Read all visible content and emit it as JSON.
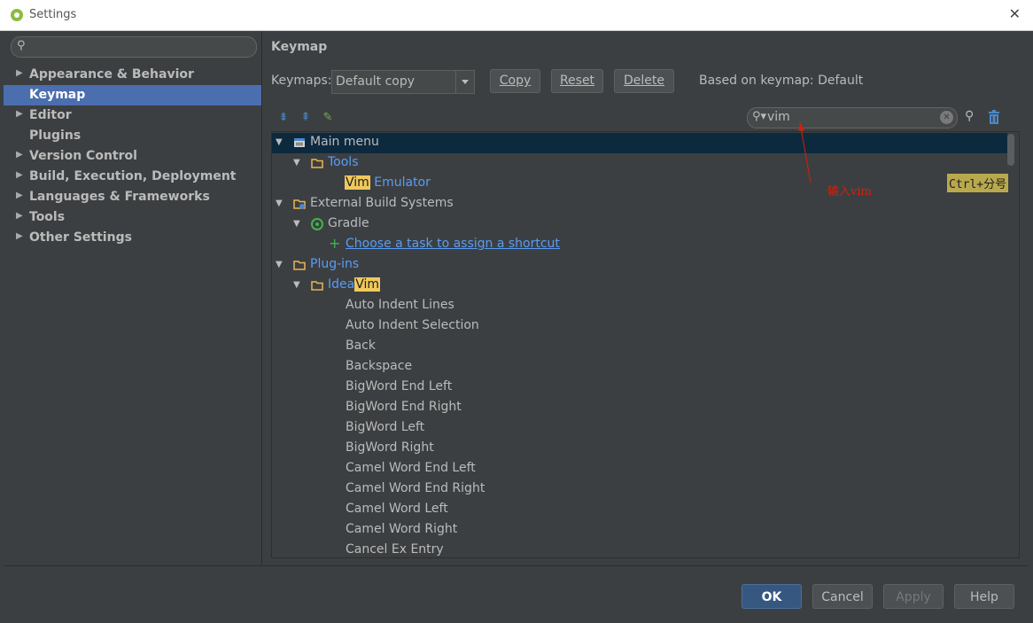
{
  "window": {
    "title": "Settings"
  },
  "sidebar": {
    "search_placeholder": "",
    "items": [
      {
        "label": "Appearance & Behavior",
        "has_arrow": true
      },
      {
        "label": "Keymap",
        "has_arrow": false,
        "selected": true
      },
      {
        "label": "Editor",
        "has_arrow": true
      },
      {
        "label": "Plugins",
        "has_arrow": false
      },
      {
        "label": "Version Control",
        "has_arrow": true
      },
      {
        "label": "Build, Execution, Deployment",
        "has_arrow": true
      },
      {
        "label": "Languages & Frameworks",
        "has_arrow": true
      },
      {
        "label": "Tools",
        "has_arrow": true
      },
      {
        "label": "Other Settings",
        "has_arrow": true
      }
    ]
  },
  "keymap": {
    "heading": "Keymap",
    "keymaps_label": "Keymaps:",
    "selected_keymap": "Default copy",
    "copy_label": "Copy",
    "reset_label": "Reset",
    "delete_label": "Delete",
    "based_on": "Based on keymap: Default",
    "filter_value": "vim"
  },
  "tree": {
    "main_menu": "Main menu",
    "tools": "Tools",
    "vim_emulator_hl": "Vim",
    "vim_emulator_rest": " Emulator",
    "vim_emulator_shortcut": "Ctrl+分号",
    "external_build": "External Build Systems",
    "gradle": "Gradle",
    "choose_task": "Choose a task to assign a shortcut",
    "plugins": "Plug-ins",
    "ideavim_pre": "Idea",
    "ideavim_hl": "Vim",
    "actions": [
      "Auto Indent Lines",
      "Auto Indent Selection",
      "Back",
      "Backspace",
      "BigWord End Left",
      "BigWord End Right",
      "BigWord Left",
      "BigWord Right",
      "Camel Word End Left",
      "Camel Word End Right",
      "Camel Word Left",
      "Camel Word Right",
      "Cancel Ex Entry"
    ]
  },
  "annotation": "输入vim",
  "footer": {
    "ok": "OK",
    "cancel": "Cancel",
    "apply": "Apply",
    "help": "Help"
  },
  "colors": {
    "selection": "#4b6eaf",
    "tree_selection": "#0d293e",
    "highlight": "#f0c95c",
    "link": "#589df6",
    "annotation": "#d81e06"
  }
}
